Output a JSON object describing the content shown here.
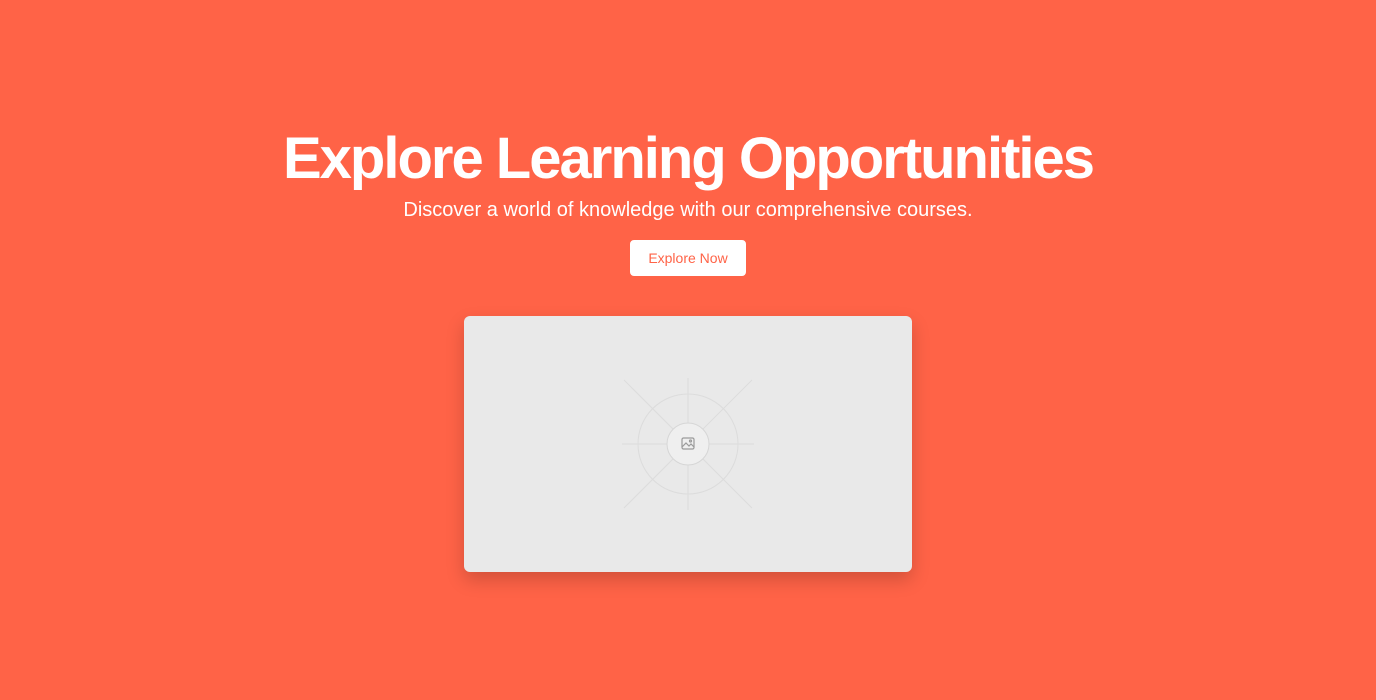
{
  "hero": {
    "title": "Explore Learning Opportunities",
    "subtitle": "Discover a world of knowledge with our comprehensive courses.",
    "cta_label": "Explore Now"
  },
  "media": {
    "icon": "image-icon"
  },
  "colors": {
    "background": "#ff6347",
    "text": "#ffffff",
    "button_background": "#ffffff",
    "button_text": "#ff6347",
    "placeholder_background": "#e9e9e9"
  }
}
